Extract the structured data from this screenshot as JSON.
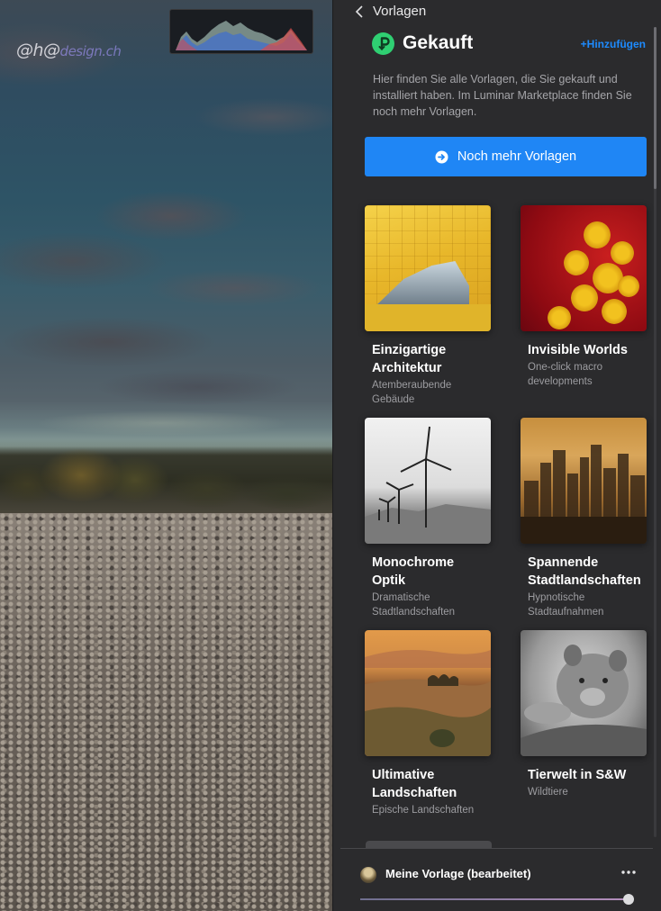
{
  "canvas": {
    "watermark": "@h@",
    "watermark_tail": "design.ch"
  },
  "panel": {
    "back_label": "Vorlagen",
    "section_title": "Gekauft",
    "add_label": "+Hinzufügen",
    "description": "Hier finden Sie alle Vorlagen, die Sie gekauft und installiert haben. Im Luminar Marketplace finden Sie noch mehr Vorlagen.",
    "cta_label": "Noch mehr Vorlagen"
  },
  "presets": [
    {
      "title": "Einzigartige Architektur",
      "subtitle": "Atemberaubende Gebäude"
    },
    {
      "title": "Invisible Worlds",
      "subtitle": "One-click macro developments"
    },
    {
      "title": "Monochrome Optik",
      "subtitle": "Dramatische Stadtlandschaften"
    },
    {
      "title": "Spannende Stadtlandschaften",
      "subtitle": "Hypnotische Stadtaufnahmen"
    },
    {
      "title": "Ultimative Landschaften",
      "subtitle": "Epische Landschaften"
    },
    {
      "title": "Tierwelt in S&W",
      "subtitle": "Wildtiere"
    }
  ],
  "footer": {
    "active_preset": "Meine Vorlage (bearbeitet)",
    "amount_fraction": 1.0
  },
  "colors": {
    "accent": "#1f86f5",
    "badge": "#2fcf72",
    "panel_bg": "#2b2b2d"
  }
}
